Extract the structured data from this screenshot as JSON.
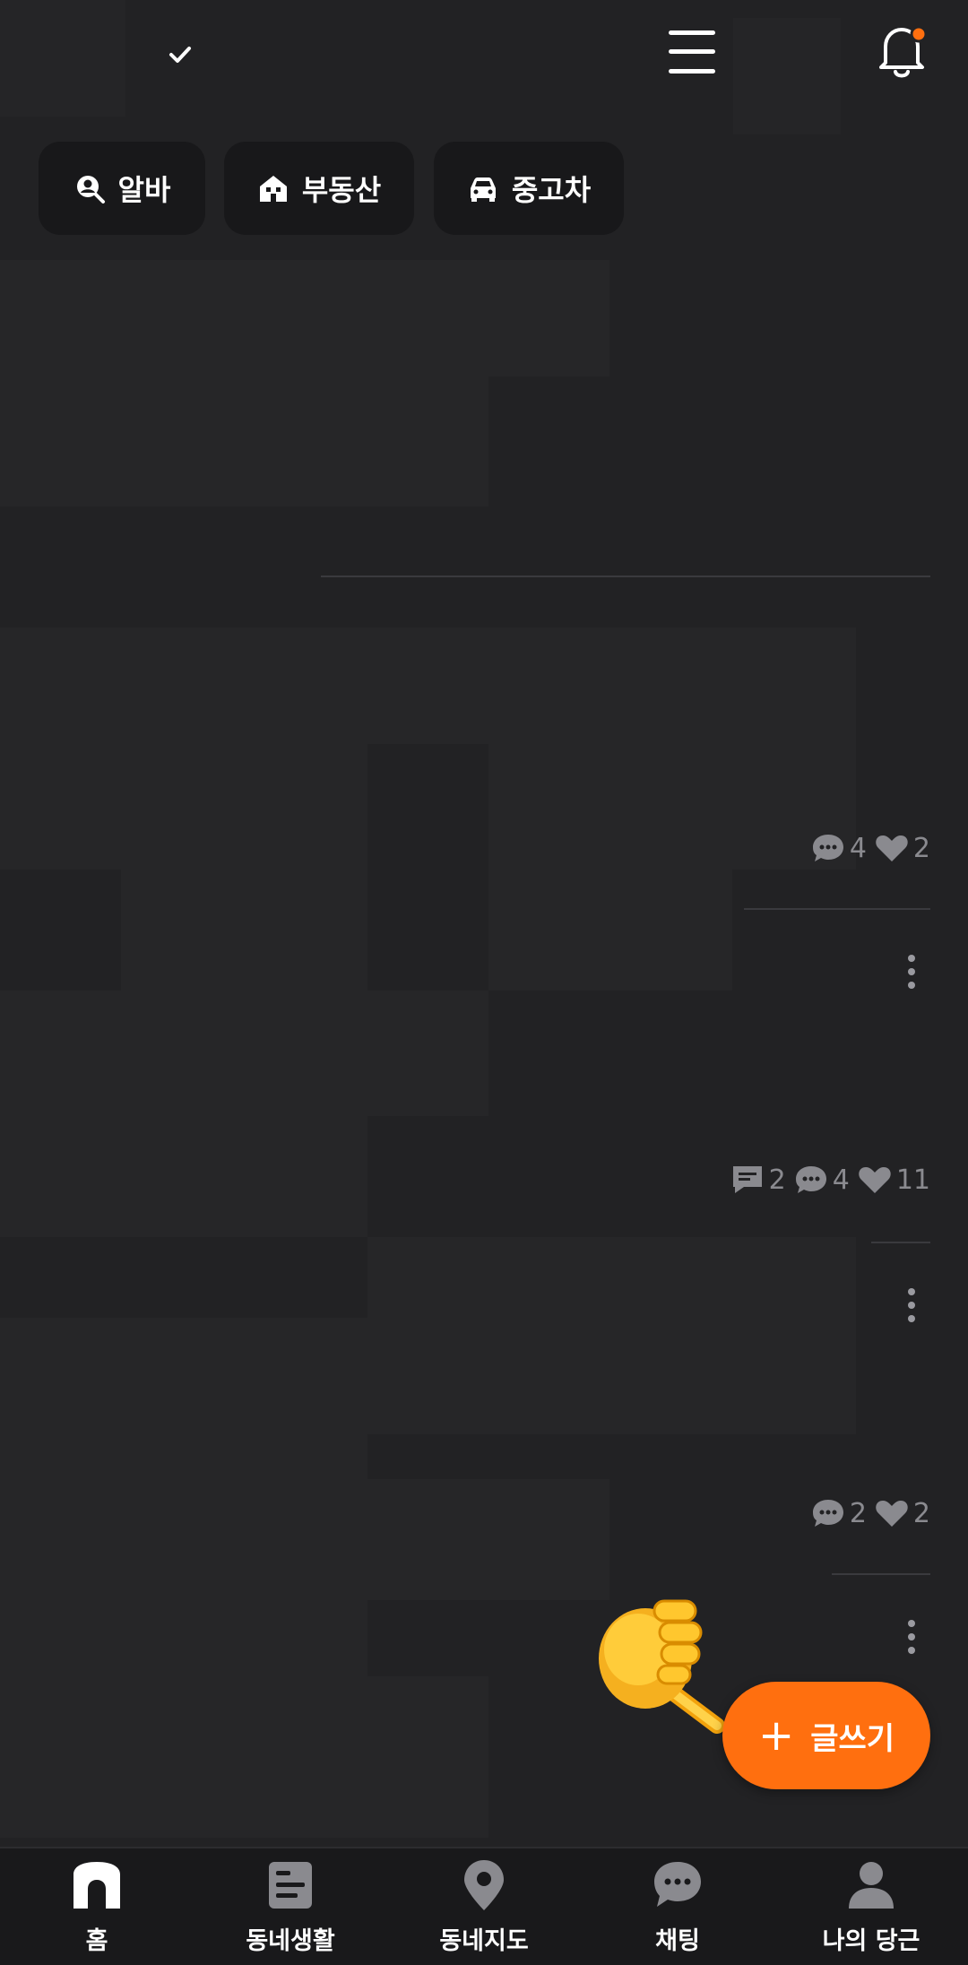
{
  "header": {
    "icons": [
      "check-icon",
      "menu-icon",
      "bell-icon"
    ],
    "has_notification_dot": true
  },
  "chips": [
    {
      "label": "알바",
      "icon": "job-search-icon"
    },
    {
      "label": "부동산",
      "icon": "house-icon"
    },
    {
      "label": "중고차",
      "icon": "car-icon"
    }
  ],
  "feed": {
    "posts": [
      {
        "comments": "4",
        "likes": "2"
      },
      {
        "replies": "2",
        "comments": "4",
        "likes": "11"
      },
      {
        "comments": "2",
        "likes": "2"
      }
    ]
  },
  "fab": {
    "label": "글쓰기",
    "plus": "+"
  },
  "nav": {
    "items": [
      {
        "label": "홈",
        "icon": "home-icon"
      },
      {
        "label": "동네생활",
        "icon": "community-icon"
      },
      {
        "label": "동네지도",
        "icon": "map-pin-icon"
      },
      {
        "label": "채팅",
        "icon": "chat-icon"
      },
      {
        "label": "나의 당근",
        "icon": "profile-icon"
      }
    ]
  },
  "colors": {
    "accent": "#ff6f0f",
    "background": "#222224",
    "muted": "#8a8a8f",
    "notification_dot": "#ff6f0f"
  }
}
